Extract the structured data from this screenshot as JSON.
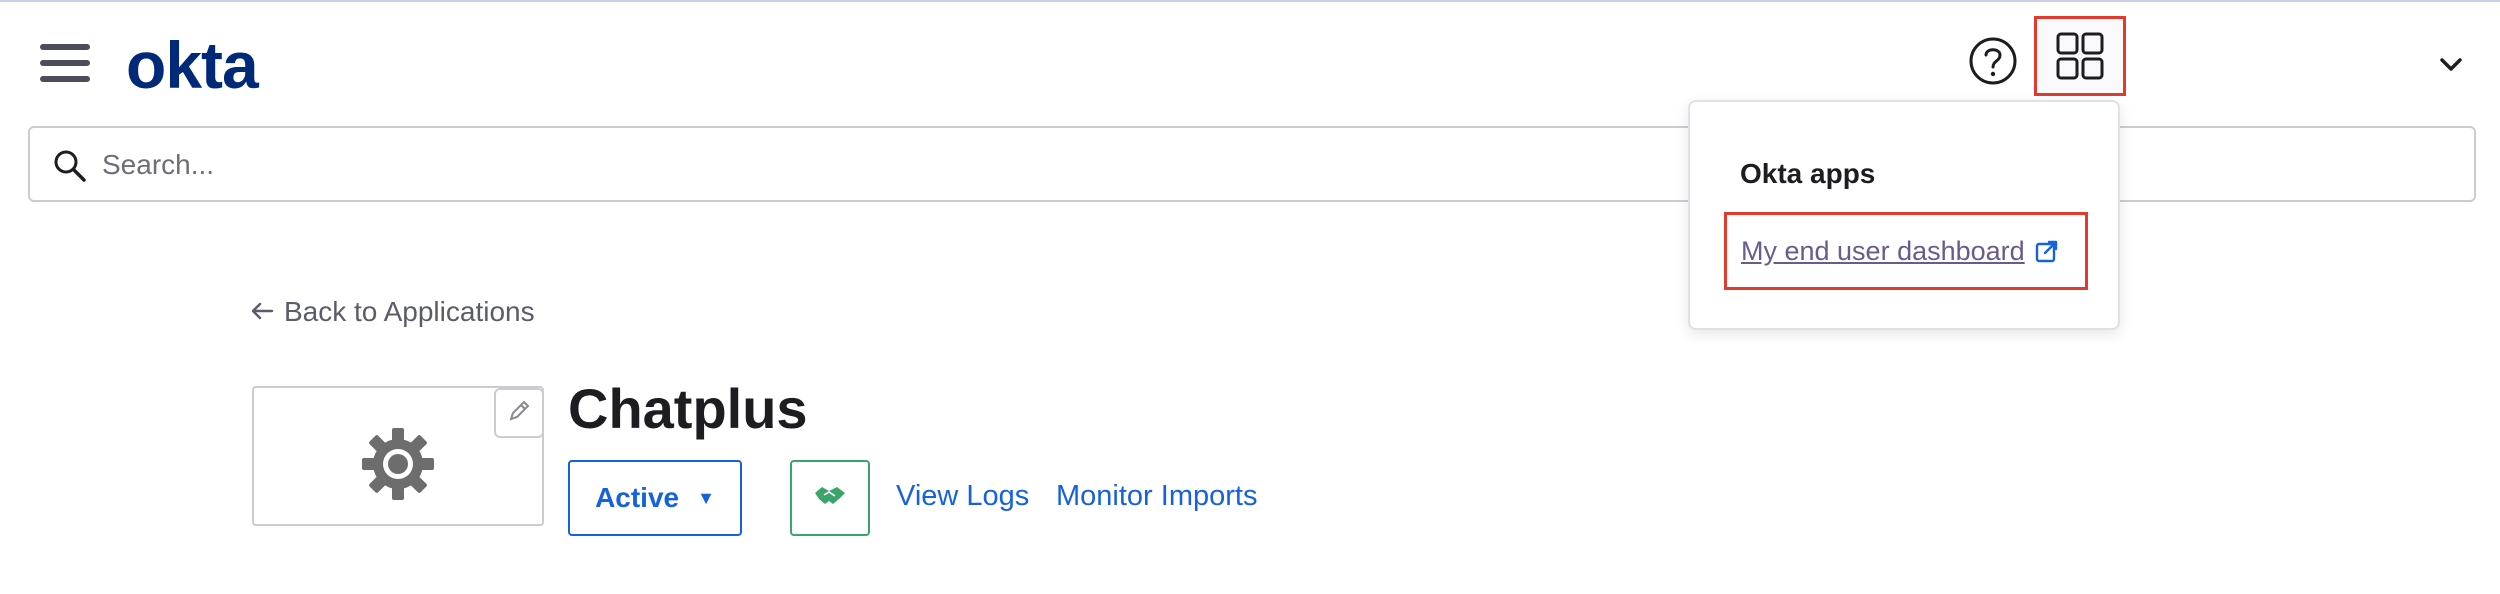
{
  "header": {
    "logo_text": "okta",
    "menu_icon": "hamburger-menu-icon",
    "help_icon": "help-circle-icon",
    "apps_icon": "apps-grid-icon",
    "user_menu_icon": "chevron-down-icon"
  },
  "search": {
    "placeholder": "Search...",
    "value": ""
  },
  "apps_dropdown": {
    "title": "Okta apps",
    "link_label": "My end user dashboard",
    "link_icon": "external-link-icon"
  },
  "back_link": {
    "label": "Back to Applications",
    "icon": "arrow-left-icon"
  },
  "app": {
    "name": "Chatplus",
    "logo_icon": "gear-icon",
    "edit_icon": "pencil-icon",
    "status_label": "Active",
    "status_caret": "▼",
    "provisioning_icon": "handshake-icon",
    "view_logs_label": "View Logs",
    "monitor_imports_label": "Monitor Imports"
  },
  "colors": {
    "brand": "#00297a",
    "link": "#1662dd",
    "highlight": "#e23b2d",
    "visited_link": "#6b5a8c",
    "success": "#3ba46b"
  }
}
